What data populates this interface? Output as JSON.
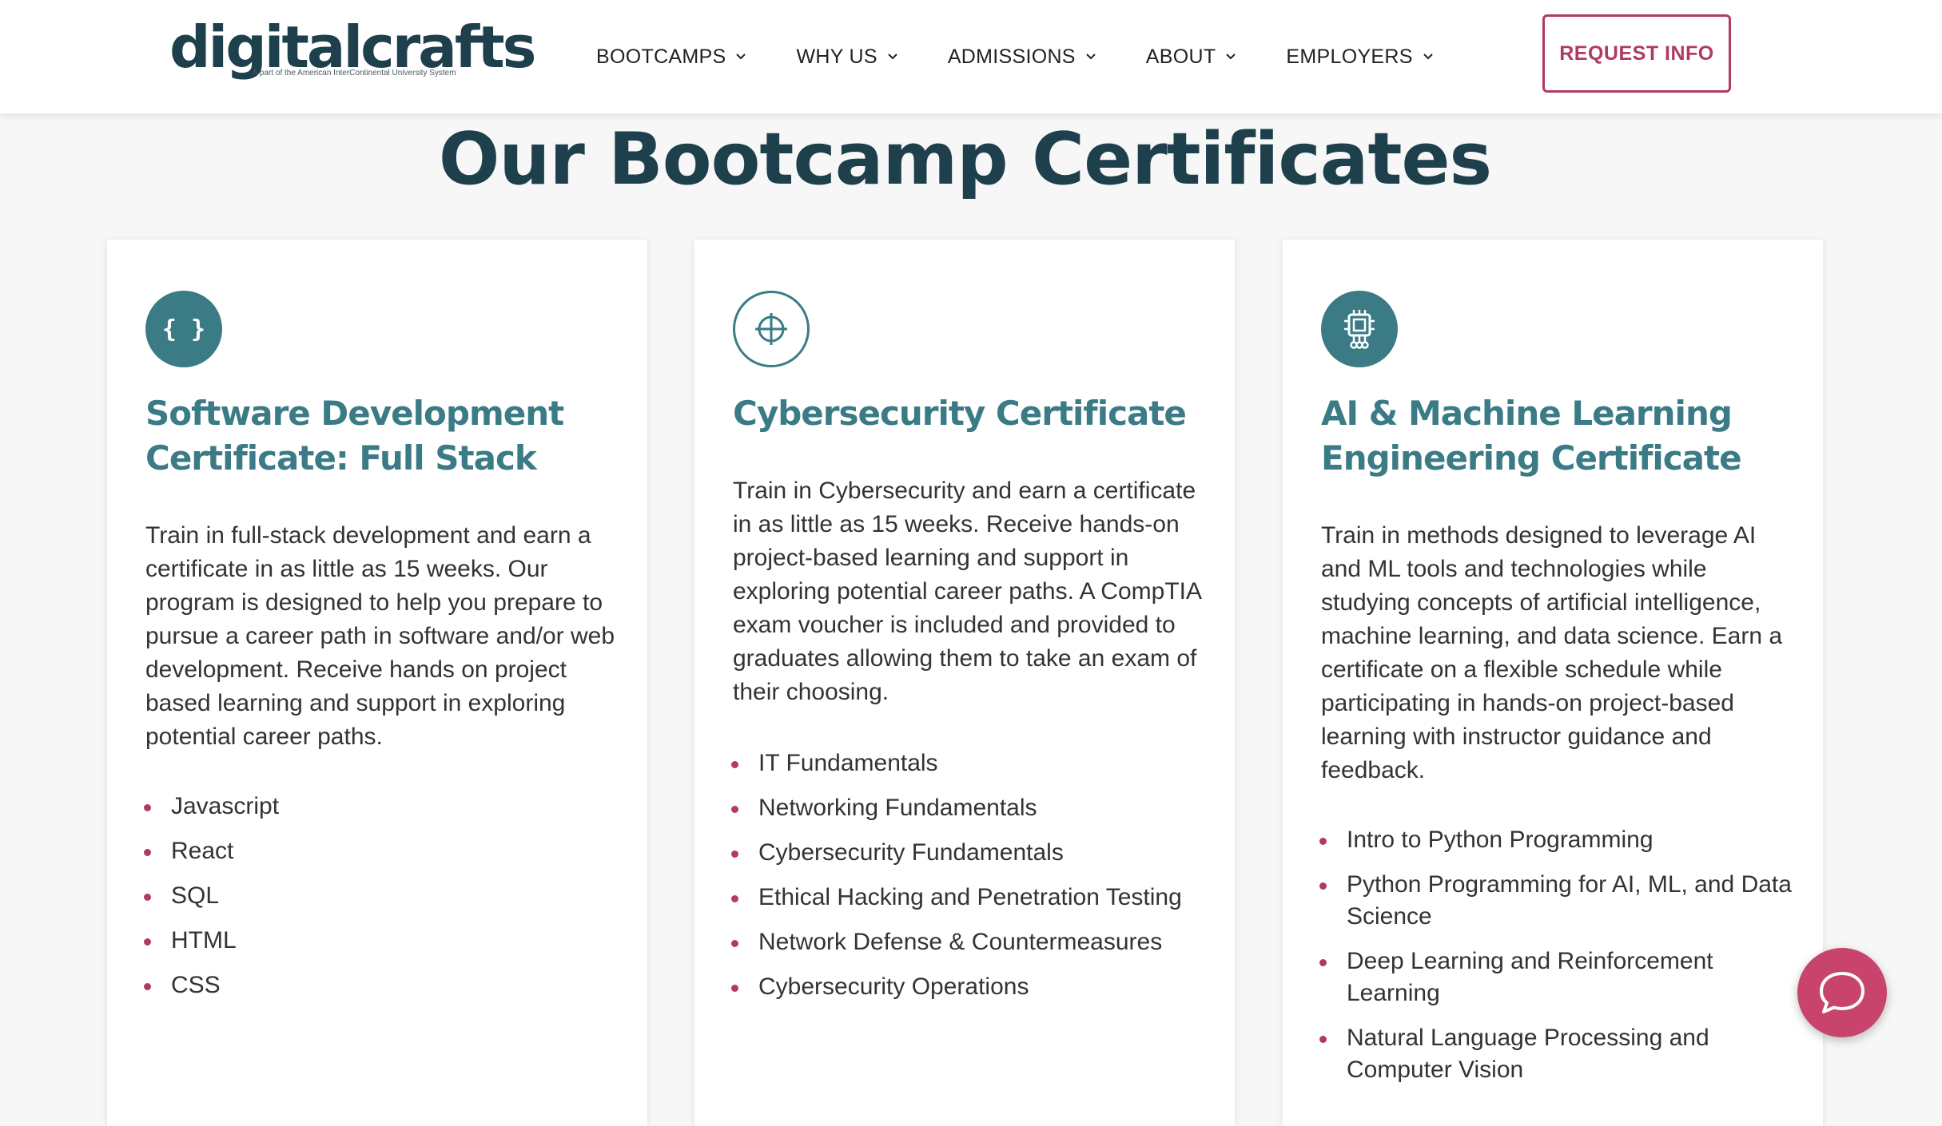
{
  "header": {
    "logo_text": "digitalcrafts",
    "logo_tagline": "A part of the American InterContinental University System",
    "nav": [
      {
        "label": "BOOTCAMPS"
      },
      {
        "label": "WHY US"
      },
      {
        "label": "ADMISSIONS"
      },
      {
        "label": "ABOUT"
      },
      {
        "label": "EMPLOYERS"
      }
    ],
    "cta_label": "REQUEST INFO"
  },
  "page": {
    "title": "Our Bootcamp Certificates"
  },
  "cards": [
    {
      "icon": "code-braces-icon",
      "icon_glyph": "{ }",
      "title": "Software Development Certificate: Full Stack",
      "description": "Train in full-stack development and earn a certificate in as little as 15 weeks. Our program is designed to help you prepare to pursue a career path in software and/or web development. Receive hands on project based learning and support in exploring potential career paths.",
      "items": [
        "Javascript",
        "React",
        "SQL",
        "HTML",
        "CSS"
      ]
    },
    {
      "icon": "crosshair-icon",
      "title": "Cybersecurity Certificate",
      "description": "Train in Cybersecurity and earn a certificate in as little as 15 weeks. Receive hands-on project-based learning and support in exploring potential career paths. A CompTIA exam voucher is included and provided to graduates allowing them to take an exam of their choosing.",
      "items": [
        "IT Fundamentals",
        "Networking Fundamentals",
        "Cybersecurity Fundamentals",
        "Ethical Hacking and Penetration Testing",
        "Network Defense & Countermeasures",
        "Cybersecurity Operations"
      ]
    },
    {
      "icon": "chip-icon",
      "title": "AI & Machine Learning Engineering Certificate",
      "description": "Train in methods designed to leverage AI and ML tools and technologies while studying concepts of artificial intelligence, machine learning, and data science. Earn a certificate on a flexible schedule while participating in hands-on project-based learning with instructor guidance and feedback.",
      "items": [
        "Intro to Python Programming",
        "Python Programming for AI, ML, and Data Science",
        "Deep Learning and Reinforcement Learning",
        "Natural Language Processing and Computer Vision"
      ]
    }
  ],
  "chat": {
    "icon": "chat-bubble-icon"
  },
  "colors": {
    "brand_dark": "#1e3f4c",
    "teal": "#3a7b85",
    "accent": "#b03a63",
    "chat": "#c9446d"
  }
}
